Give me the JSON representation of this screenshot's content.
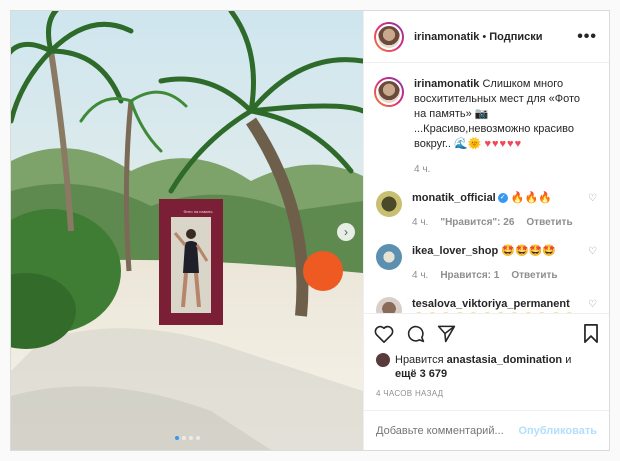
{
  "header": {
    "username": "irinamonatik",
    "separator": "•",
    "follow_label": "Подписки",
    "more_label": "•••"
  },
  "photo": {
    "frame_text": "Фото на память",
    "next_label": "›",
    "slide_count": 4,
    "active_slide": 1
  },
  "caption": {
    "username": "irinamonatik",
    "text": "Слишком много восхитительных мест для «Фото на память» 📷 ...Красиво,невозможно красиво вокруг.. 🌊🌞",
    "hearts": "♥♥♥♥♥",
    "time": "4 ч."
  },
  "comments": [
    {
      "username": "monatik_official",
      "verified": "✓",
      "text": "🔥🔥🔥",
      "time": "4 ч.",
      "likes": "\"Нравится\": 26",
      "reply": "Ответить",
      "like_icon": "♡"
    },
    {
      "username": "ikea_lover_shop",
      "text": "🤩🤩🤩🤩",
      "time": "4 ч.",
      "likes": "Нравится: 1",
      "reply": "Ответить",
      "like_icon": "♡"
    },
    {
      "username": "tesalova_viktoriya_permanent",
      "text": "🤩🤩🤩🤩🤩🤩🤩🤩🤩🤩🤩🤩",
      "like_icon": "♡"
    }
  ],
  "likes": {
    "prefix": "Нравится",
    "user": "anastasia_domination",
    "mid": "и",
    "more": "ещё 3 679"
  },
  "timestamp": "4 ЧАСОВ НАЗАД",
  "add_comment": {
    "placeholder": "Добавьте комментарий...",
    "publish_label": "Опубликовать"
  },
  "colors": {
    "accent": "#3897f0",
    "heart": "#ed4956",
    "publish_disabled": "#b2dffc"
  }
}
